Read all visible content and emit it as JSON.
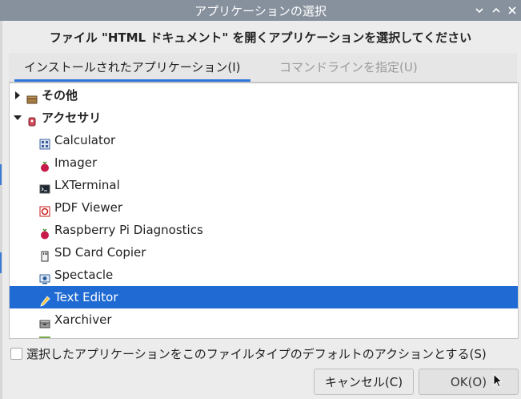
{
  "window": {
    "title": "アプリケーションの選択",
    "buttons": [
      "minimize",
      "maximize",
      "close"
    ]
  },
  "heading": "ファイル \"HTML ドキュメント\" を開くアプリケーションを選択してください",
  "tabs": [
    {
      "label": "インストールされたアプリケーション(I)",
      "active": true
    },
    {
      "label": "コマンドラインを指定(U)",
      "active": false
    }
  ],
  "tree": {
    "categories": [
      {
        "label": "その他",
        "expanded": false,
        "icon": "box-icon"
      },
      {
        "label": "アクセサリ",
        "expanded": true,
        "icon": "accessories-icon"
      }
    ],
    "apps": [
      {
        "label": "Calculator",
        "icon": "calculator-icon"
      },
      {
        "label": "Imager",
        "icon": "raspberry-icon"
      },
      {
        "label": "LXTerminal",
        "icon": "terminal-icon"
      },
      {
        "label": "PDF Viewer",
        "icon": "pdf-icon"
      },
      {
        "label": "Raspberry Pi Diagnostics",
        "icon": "raspberry-icon"
      },
      {
        "label": "SD Card Copier",
        "icon": "sdcard-icon"
      },
      {
        "label": "Spectacle",
        "icon": "screenshot-icon"
      },
      {
        "label": "Text Editor",
        "icon": "pencil-icon",
        "selected": true
      },
      {
        "label": "Xarchiver",
        "icon": "archive-icon"
      }
    ]
  },
  "default_checkbox": {
    "label": "選択したアプリケーションをこのファイルタイプのデフォルトのアクションとする(S)",
    "checked": false
  },
  "buttons": {
    "cancel": "キャンセル(C)",
    "ok": "OK(O)"
  },
  "colors": {
    "titlebar": "#87919e",
    "selection": "#1f6bd3",
    "tab_underline": "#2f75d8"
  }
}
